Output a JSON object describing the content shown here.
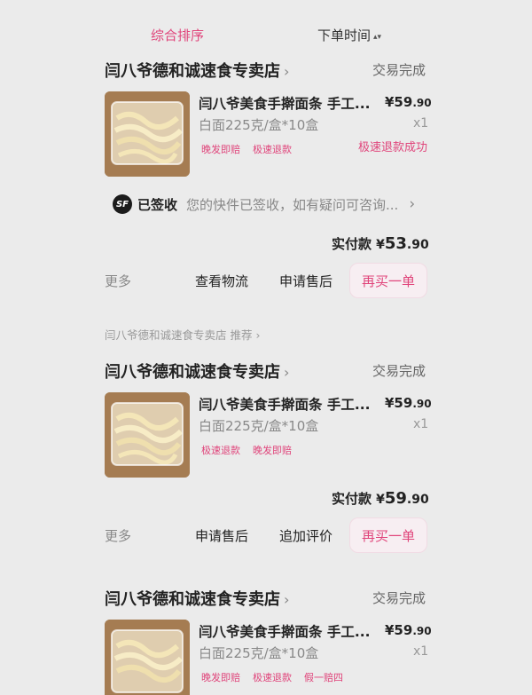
{
  "sort_bar": {
    "tab_comprehensive": "综合排序",
    "tab_order_time": "下单时间",
    "sort_arrows": "▴▾"
  },
  "orders": [
    {
      "shop": "闫八爷德和诚速食专卖店",
      "status": "交易完成",
      "product": "闫八爷美食手擀面条 手工...",
      "spec": "白面225克/盒*10盒",
      "price_int": "¥59",
      "price_dec": ".90",
      "qty": "x1",
      "tags": [
        "晚发即赔",
        "极速退款"
      ],
      "refund_status": "极速退款成功",
      "logistics": {
        "badge": "SF",
        "state": "已签收",
        "message": "您的快件已签收，如有疑问可咨询...",
        "chevron": "›"
      },
      "total_label": "实付款",
      "total_yen": "¥",
      "total_int": "53",
      "total_dec": ".90",
      "more": "更多",
      "buttons": [
        "查看物流",
        "申请售后",
        "再买一单"
      ]
    },
    {
      "recommend": "闫八爷德和诚速食专卖店 推荐 ›",
      "shop": "闫八爷德和诚速食专卖店",
      "status": "交易完成",
      "product": "闫八爷美食手擀面条 手工...",
      "spec": "白面225克/盒*10盒",
      "price_int": "¥59",
      "price_dec": ".90",
      "qty": "x1",
      "tags": [
        "极速退款",
        "晚发即赔"
      ],
      "total_label": "实付款",
      "total_yen": "¥",
      "total_int": "59",
      "total_dec": ".90",
      "more": "更多",
      "buttons": [
        "申请售后",
        "追加评价",
        "再买一单"
      ]
    },
    {
      "shop": "闫八爷德和诚速食专卖店",
      "status": "交易完成",
      "product": "闫八爷美食手擀面条 手工...",
      "spec": "白面225克/盒*10盒",
      "price_int": "¥59",
      "price_dec": ".90",
      "qty": "x1",
      "tags": [
        "晚发即赔",
        "极速退款",
        "假一赔四"
      ]
    }
  ],
  "colors": {
    "accent": "#e0457b",
    "background": "#ebebeb"
  },
  "icons": {
    "shop_chevron": "›",
    "thumbnail": "noodle-product-thumbnail"
  }
}
